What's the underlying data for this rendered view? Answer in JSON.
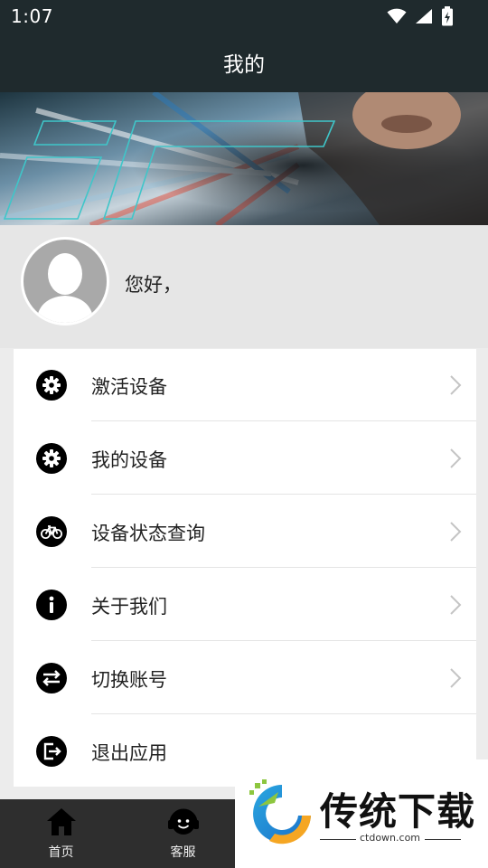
{
  "status_bar": {
    "time": "1:07",
    "icons": [
      "wifi-icon",
      "cellular-icon",
      "battery-icon"
    ]
  },
  "header": {
    "title": "我的"
  },
  "profile": {
    "greeting": "您好，"
  },
  "menu": {
    "items": [
      {
        "label": "激活设备",
        "icon": "gear-icon",
        "chevron": true
      },
      {
        "label": "我的设备",
        "icon": "gear-icon",
        "chevron": true
      },
      {
        "label": "设备状态查询",
        "icon": "bicycle-icon",
        "chevron": true
      },
      {
        "label": "关于我们",
        "icon": "info-icon",
        "chevron": true
      },
      {
        "label": "切换账号",
        "icon": "swap-icon",
        "chevron": true
      },
      {
        "label": "退出应用",
        "icon": "logout-icon",
        "chevron": false
      }
    ]
  },
  "bottom_nav": {
    "items": [
      {
        "label": "首页",
        "icon": "home-icon"
      },
      {
        "label": "客服",
        "icon": "headset-icon"
      }
    ]
  },
  "watermark": {
    "text": "传统下载",
    "url": "ctdown.com"
  },
  "colors": {
    "header_bg": "#1f2a2d",
    "page_bg": "#ececec",
    "bottom_nav_bg": "#2e2e2e",
    "icon": "#000000",
    "chevron": "#c4c4c4"
  }
}
